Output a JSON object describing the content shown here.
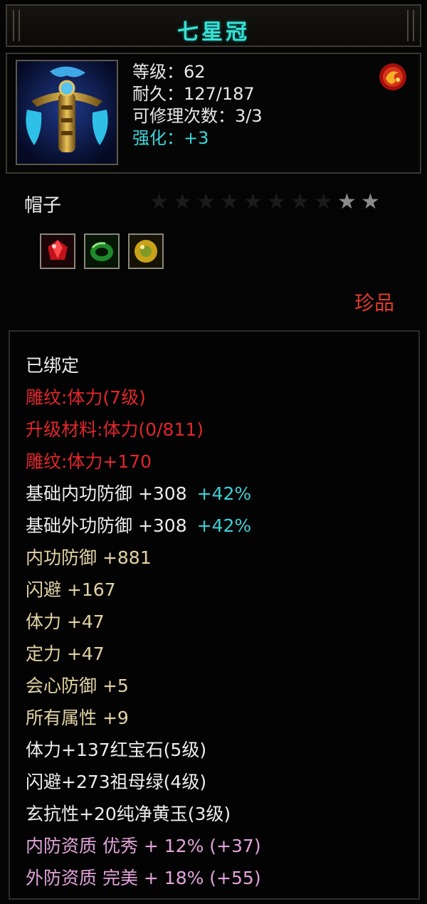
{
  "item": {
    "name": "七星冠",
    "level_label": "等级：62",
    "durability_label": "耐久：127/187",
    "repair_label": "可修理次数：3/3",
    "enhance_label": "强化：+3",
    "type": "帽子",
    "stars_filled": 2,
    "stars_total": 10,
    "rarity": "珍品",
    "gem_slots": [
      "ruby-gem-icon",
      "emerald-gem-icon",
      "yellow-jade-gem-icon"
    ]
  },
  "attributes": [
    {
      "text": "已绑定",
      "color": "white"
    },
    {
      "text": "雕纹:体力(7级)",
      "color": "red"
    },
    {
      "text": "升级材料:体力(0/811)",
      "color": "red"
    },
    {
      "text": "雕纹:体力+170",
      "color": "red"
    },
    {
      "text": "基础内功防御 +308",
      "extra": "+42%",
      "color": "white"
    },
    {
      "text": "基础外功防御 +308",
      "extra": "+42%",
      "color": "white"
    },
    {
      "text": "内功防御 +881",
      "color": "gold"
    },
    {
      "text": "闪避 +167",
      "color": "gold"
    },
    {
      "text": "体力 +47",
      "color": "gold"
    },
    {
      "text": "定力 +47",
      "color": "gold"
    },
    {
      "text": "会心防御 +5",
      "color": "gold"
    },
    {
      "text": "所有属性 +9",
      "color": "gold"
    },
    {
      "text": "体力+137红宝石(5级)",
      "color": "white"
    },
    {
      "text": "闪避+273祖母绿(4级)",
      "color": "white"
    },
    {
      "text": "玄抗性+20纯净黄玉(3级)",
      "color": "white"
    },
    {
      "text": "内防资质 优秀 + 12% (+37)",
      "color": "pink"
    },
    {
      "text": "外防资质 完美 + 18% (+55)",
      "color": "pink"
    }
  ],
  "colors": {
    "title": "#37e0d4",
    "red": "#e0262b",
    "gold": "#e3d3a4",
    "pink": "#e2a3da",
    "cyan": "#3bd0d6"
  }
}
